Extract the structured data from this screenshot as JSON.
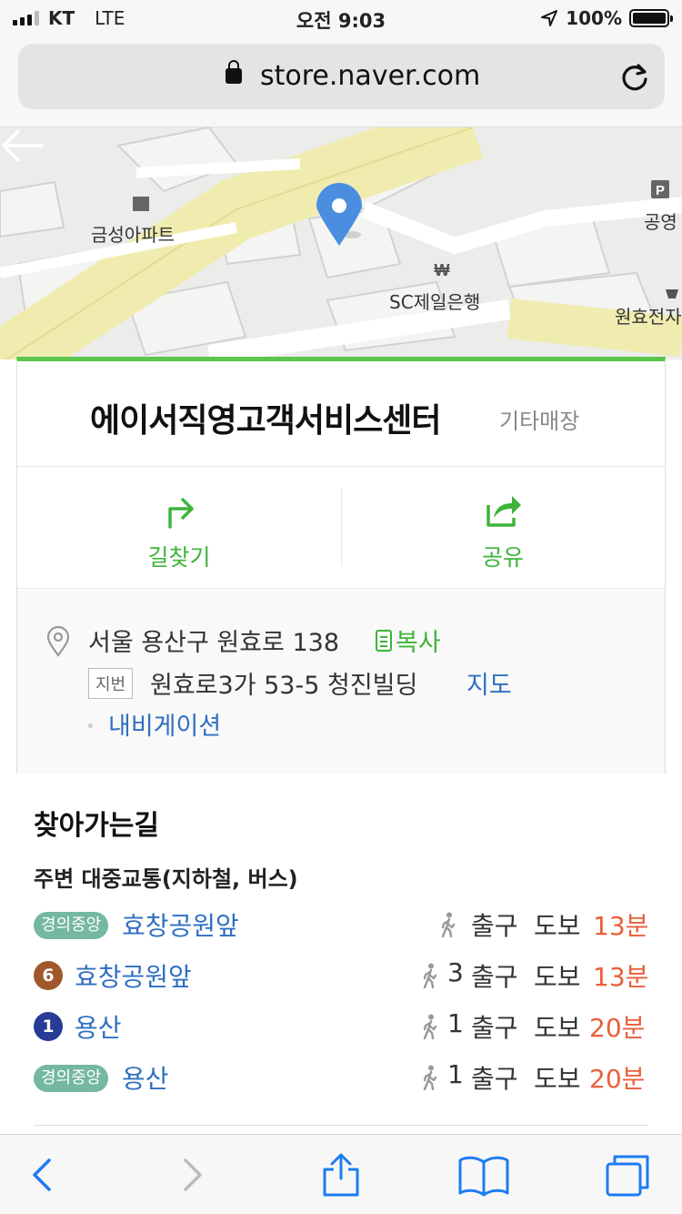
{
  "status": {
    "carrier": "KT",
    "network": "LTE",
    "time": "오전 9:03",
    "battery": "100%"
  },
  "browser": {
    "url": "store.naver.com"
  },
  "map": {
    "labels": {
      "apartment": "금성아파트",
      "bank": "SC제일은행",
      "park": "공영",
      "store": "원효전자",
      "bank_symbol": "₩",
      "parking_symbol": "P"
    }
  },
  "store": {
    "name": "에이서직영고객서비스센터",
    "category": "기타매장",
    "actions": {
      "directions": "길찾기",
      "share": "공유"
    },
    "address": "서울 용산구 원효로 138",
    "copy": "복사",
    "jibun_badge": "지번",
    "jibun": "원효로3가 53-5 청진빌딩",
    "map_link": "지도",
    "navigation": "내비게이션"
  },
  "directions": {
    "title": "찾아가는길",
    "transit_title": "주변 대중교통(지하철, 버스)",
    "exit_label": "출구",
    "walk_label": "도보",
    "rows": [
      {
        "line": "경의중앙",
        "station": "효창공원앞",
        "exit": "",
        "minutes": "13분"
      },
      {
        "line": "6",
        "station": "효창공원앞",
        "exit": "3",
        "minutes": "13분"
      },
      {
        "line": "1",
        "station": "용산",
        "exit": "1",
        "minutes": "20분"
      },
      {
        "line": "경의중앙",
        "station": "용산",
        "exit": "1",
        "minutes": "20분"
      }
    ]
  },
  "colors": {
    "accent_green": "#3fb43a",
    "link_blue": "#2f6fc1",
    "minutes_orange": "#e8603a",
    "line_6": "#a0582a",
    "line_1": "#263c96",
    "line_gyeongui": "#74b7a3"
  }
}
